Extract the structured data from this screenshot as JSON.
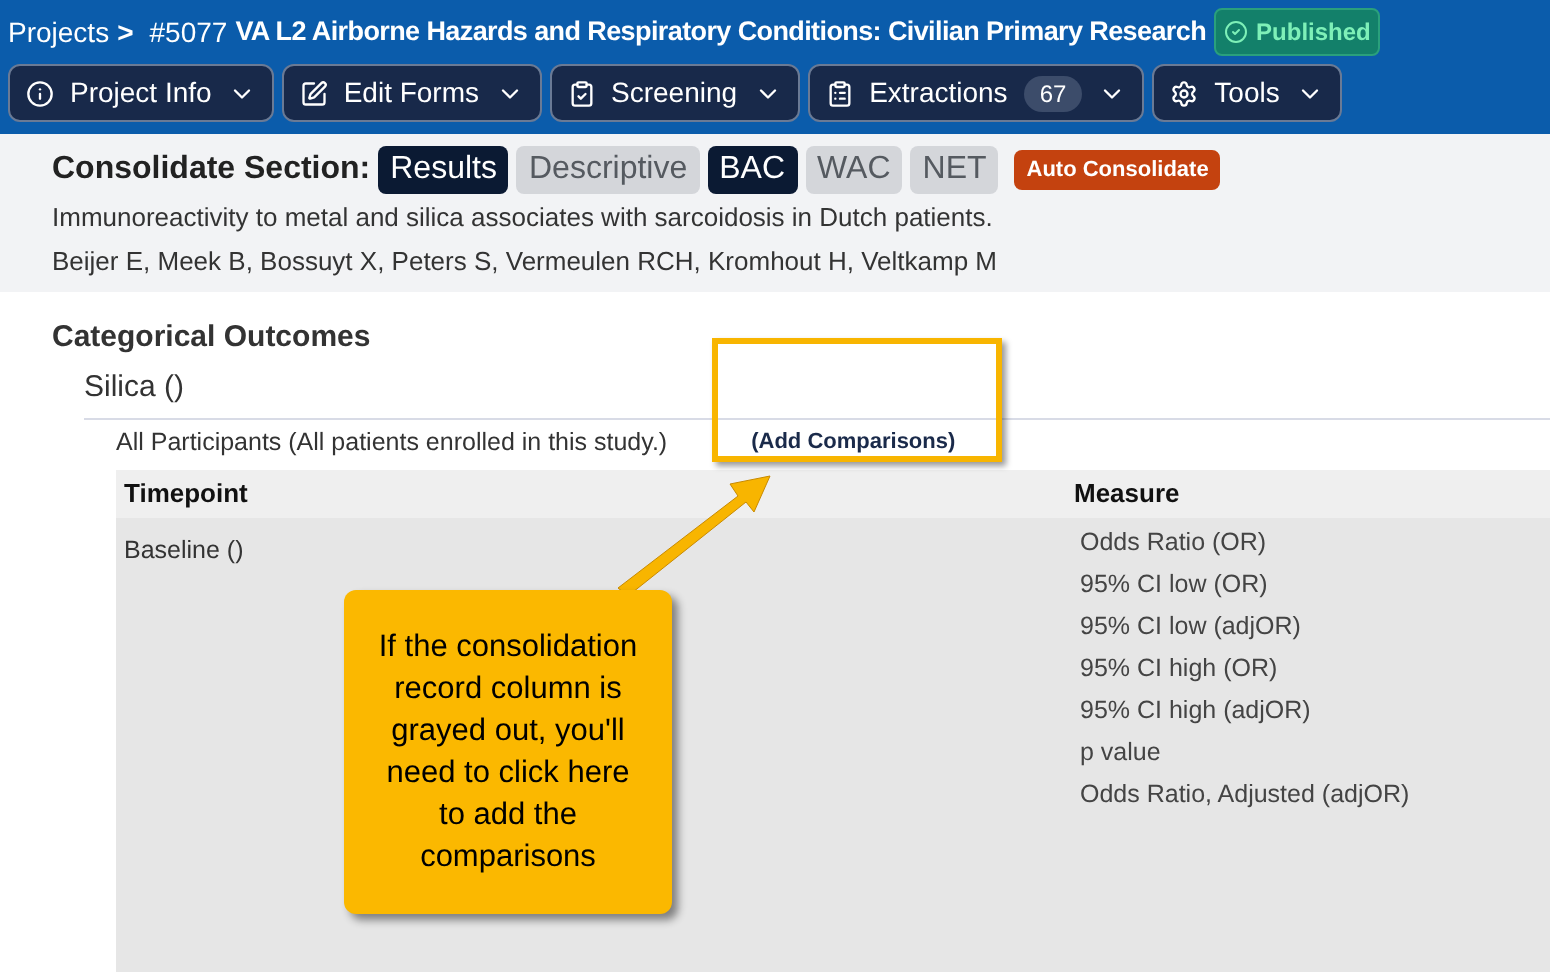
{
  "breadcrumb": {
    "root": "Projects",
    "separator": ">",
    "project_id": "#5077",
    "project_title": "VA L2 Airborne Hazards and Respiratory Conditions: Civilian Primary Research",
    "status": "Published"
  },
  "nav": [
    {
      "kind": "info",
      "label": "Project Info"
    },
    {
      "kind": "edit",
      "label": "Edit Forms"
    },
    {
      "kind": "screening",
      "label": "Screening"
    },
    {
      "kind": "extractions",
      "label": "Extractions",
      "count": "67"
    },
    {
      "kind": "tools",
      "label": "Tools"
    }
  ],
  "consolidate": {
    "label": "Consolidate Section:",
    "sections": [
      {
        "label": "Results",
        "selected": true
      },
      {
        "label": "Descriptive",
        "selected": false
      }
    ],
    "groups": [
      {
        "label": "BAC",
        "selected": true
      },
      {
        "label": "WAC",
        "selected": false
      },
      {
        "label": "NET",
        "selected": false
      }
    ],
    "auto_button": "Auto Consolidate",
    "title": "Immunoreactivity to metal and silica associates with sarcoidosis in Dutch patients.",
    "authors": "Beijer E, Meek B, Bossuyt X, Peters S, Vermeulen RCH, Kromhout H, Veltkamp M"
  },
  "outcomes": {
    "heading": "Categorical Outcomes",
    "outcome": "Silica ()",
    "population": "All Participants (All patients enrolled in this study.)",
    "add_link": "(Add Comparisons)",
    "columns": [
      "Timepoint",
      "Measure"
    ],
    "rows": [
      {
        "timepoint": "Baseline ()",
        "measures": [
          "Odds Ratio (OR)",
          "95% CI low (OR)",
          "95% CI low (adjOR)",
          "95% CI high (OR)",
          "95% CI high (adjOR)",
          "p value",
          "Odds Ratio, Adjusted (adjOR)"
        ]
      }
    ]
  },
  "callout": {
    "text": "If the consolidation record column is grayed out, you'll need to click here to add the comparisons"
  }
}
